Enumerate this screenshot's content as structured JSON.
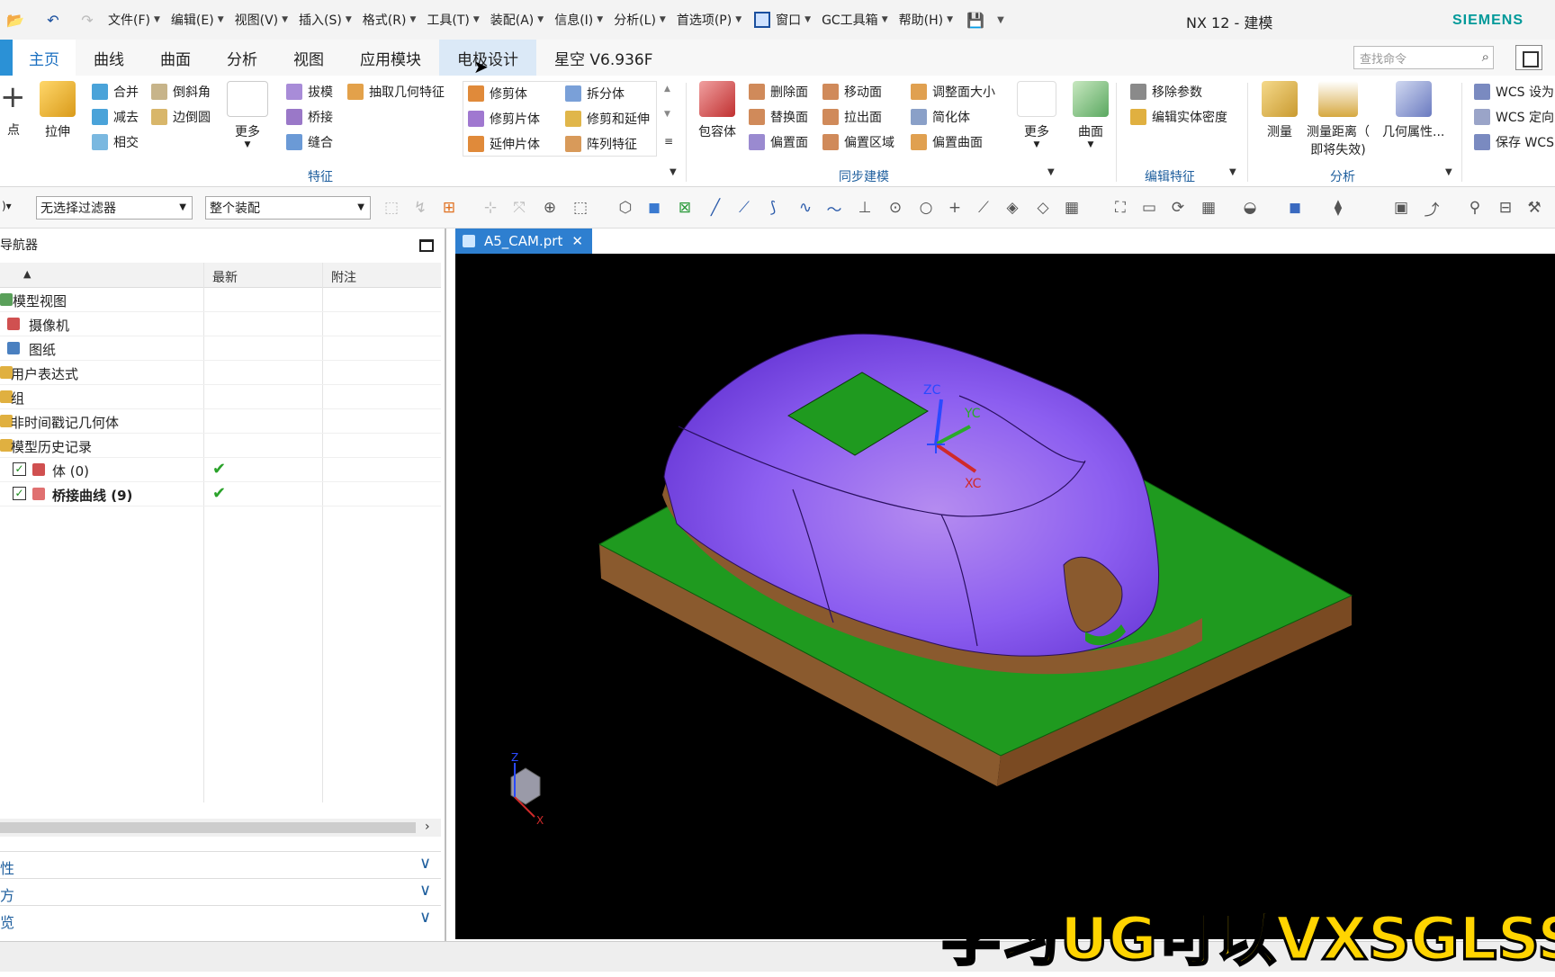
{
  "titlebar": {
    "menus": [
      "文件(F)",
      "编辑(E)",
      "视图(V)",
      "插入(S)",
      "格式(R)",
      "工具(T)",
      "装配(A)",
      "信息(I)",
      "分析(L)",
      "首选项(P)",
      "窗口",
      "GC工具箱",
      "帮助(H)"
    ],
    "title": "NX 12 - 建模",
    "brand": "SIEMENS"
  },
  "tabs": [
    "主页",
    "曲线",
    "曲面",
    "分析",
    "视图",
    "应用模块",
    "电极设计",
    "星空 V6.936F"
  ],
  "command_search": {
    "placeholder": "查找命令"
  },
  "ribbon": {
    "point_label": "点",
    "extrude_label": "拉伸",
    "more_label": "更多",
    "col1": [
      "合并",
      "减去",
      "相交"
    ],
    "col2": [
      "倒斜角",
      "边倒圆"
    ],
    "col3": [
      "拔模",
      "桥接",
      "缝合"
    ],
    "extract_label": "抽取几何特征",
    "trim_col1": [
      "修剪体",
      "修剪片体",
      "延伸片体"
    ],
    "trim_col2": [
      "拆分体",
      "修剪和延伸",
      "阵列特征"
    ],
    "feature_group": "特征",
    "wrap_label": "包容体",
    "sync_col1": [
      "删除面",
      "替换面",
      "偏置面"
    ],
    "sync_col2": [
      "移动面",
      "拉出面",
      "偏置区域"
    ],
    "sync_col3": [
      "调整面大小",
      "简化体",
      "偏置曲面"
    ],
    "sync_more": "更多",
    "sync_group": "同步建模",
    "surface_label": "曲面",
    "edit_items": [
      "移除参数",
      "编辑实体密度"
    ],
    "edit_group": "编辑特征",
    "measure_label": "测量",
    "measure_dist_label_1": "测量距离（",
    "measure_dist_label_2": "即将失效)",
    "geom_props_label": "几何属性...",
    "analysis_group": "分析",
    "wcs_items": [
      "WCS 设为",
      "WCS 定向",
      "保存 WCS"
    ]
  },
  "toolbar2": {
    "filter": "无选择过滤器",
    "scope": "整个装配"
  },
  "navigator": {
    "title": "导航器",
    "columns": [
      "最新",
      "附注"
    ],
    "rows": [
      {
        "label": "模型视图"
      },
      {
        "label": "摄像机"
      },
      {
        "label": "图纸"
      },
      {
        "label": "用户表达式"
      },
      {
        "label": "组"
      },
      {
        "label": "非时间戳记几何体"
      },
      {
        "label": "模型历史记录"
      },
      {
        "label": "体 (0)",
        "latest": "✔"
      },
      {
        "label": "桥接曲线 (9)",
        "latest": "✔"
      }
    ],
    "panels": [
      "性",
      "方",
      "览"
    ]
  },
  "document_tab": "A5_CAM.prt",
  "viewport": {
    "wcs_axes": [
      "ZC",
      "YC",
      "XC"
    ],
    "triad_axes": [
      "Z",
      "X"
    ]
  },
  "overlay_caption": "学习UG可以VXSGLSS"
}
